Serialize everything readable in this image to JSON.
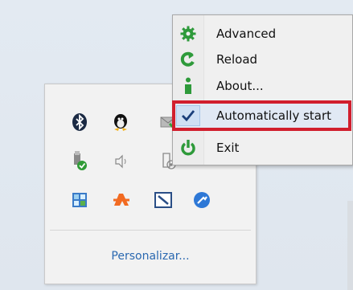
{
  "context_menu": {
    "items": [
      {
        "label": "Advanced",
        "icon": "gear-icon",
        "icon_color": "#2e9a3a",
        "checked": false
      },
      {
        "label": "Reload",
        "icon": "reload-icon",
        "icon_color": "#2e9a3a",
        "checked": false
      },
      {
        "label": "About...",
        "icon": "info-icon",
        "icon_color": "#2e9a3a",
        "checked": false
      },
      {
        "label": "Automatically start",
        "icon": "checkmark-icon",
        "icon_color": "#1a3f7a",
        "checked": true
      },
      {
        "label": "Exit",
        "icon": "power-icon",
        "icon_color": "#2e9a3a",
        "checked": false
      }
    ],
    "highlighted_item": "Automatically start",
    "highlight_color": "#d11f2e"
  },
  "tray_panel": {
    "icons": [
      "bluetooth-icon",
      "tux-icon",
      "mail-check-icon",
      "usb-safely-remove-icon",
      "speaker-icon",
      "disk-gear-icon",
      "map-icon",
      "avast-icon",
      "window-app-icon",
      "tool-icon"
    ],
    "link_label": "Personalizar...",
    "link_color": "#2a68b0"
  }
}
